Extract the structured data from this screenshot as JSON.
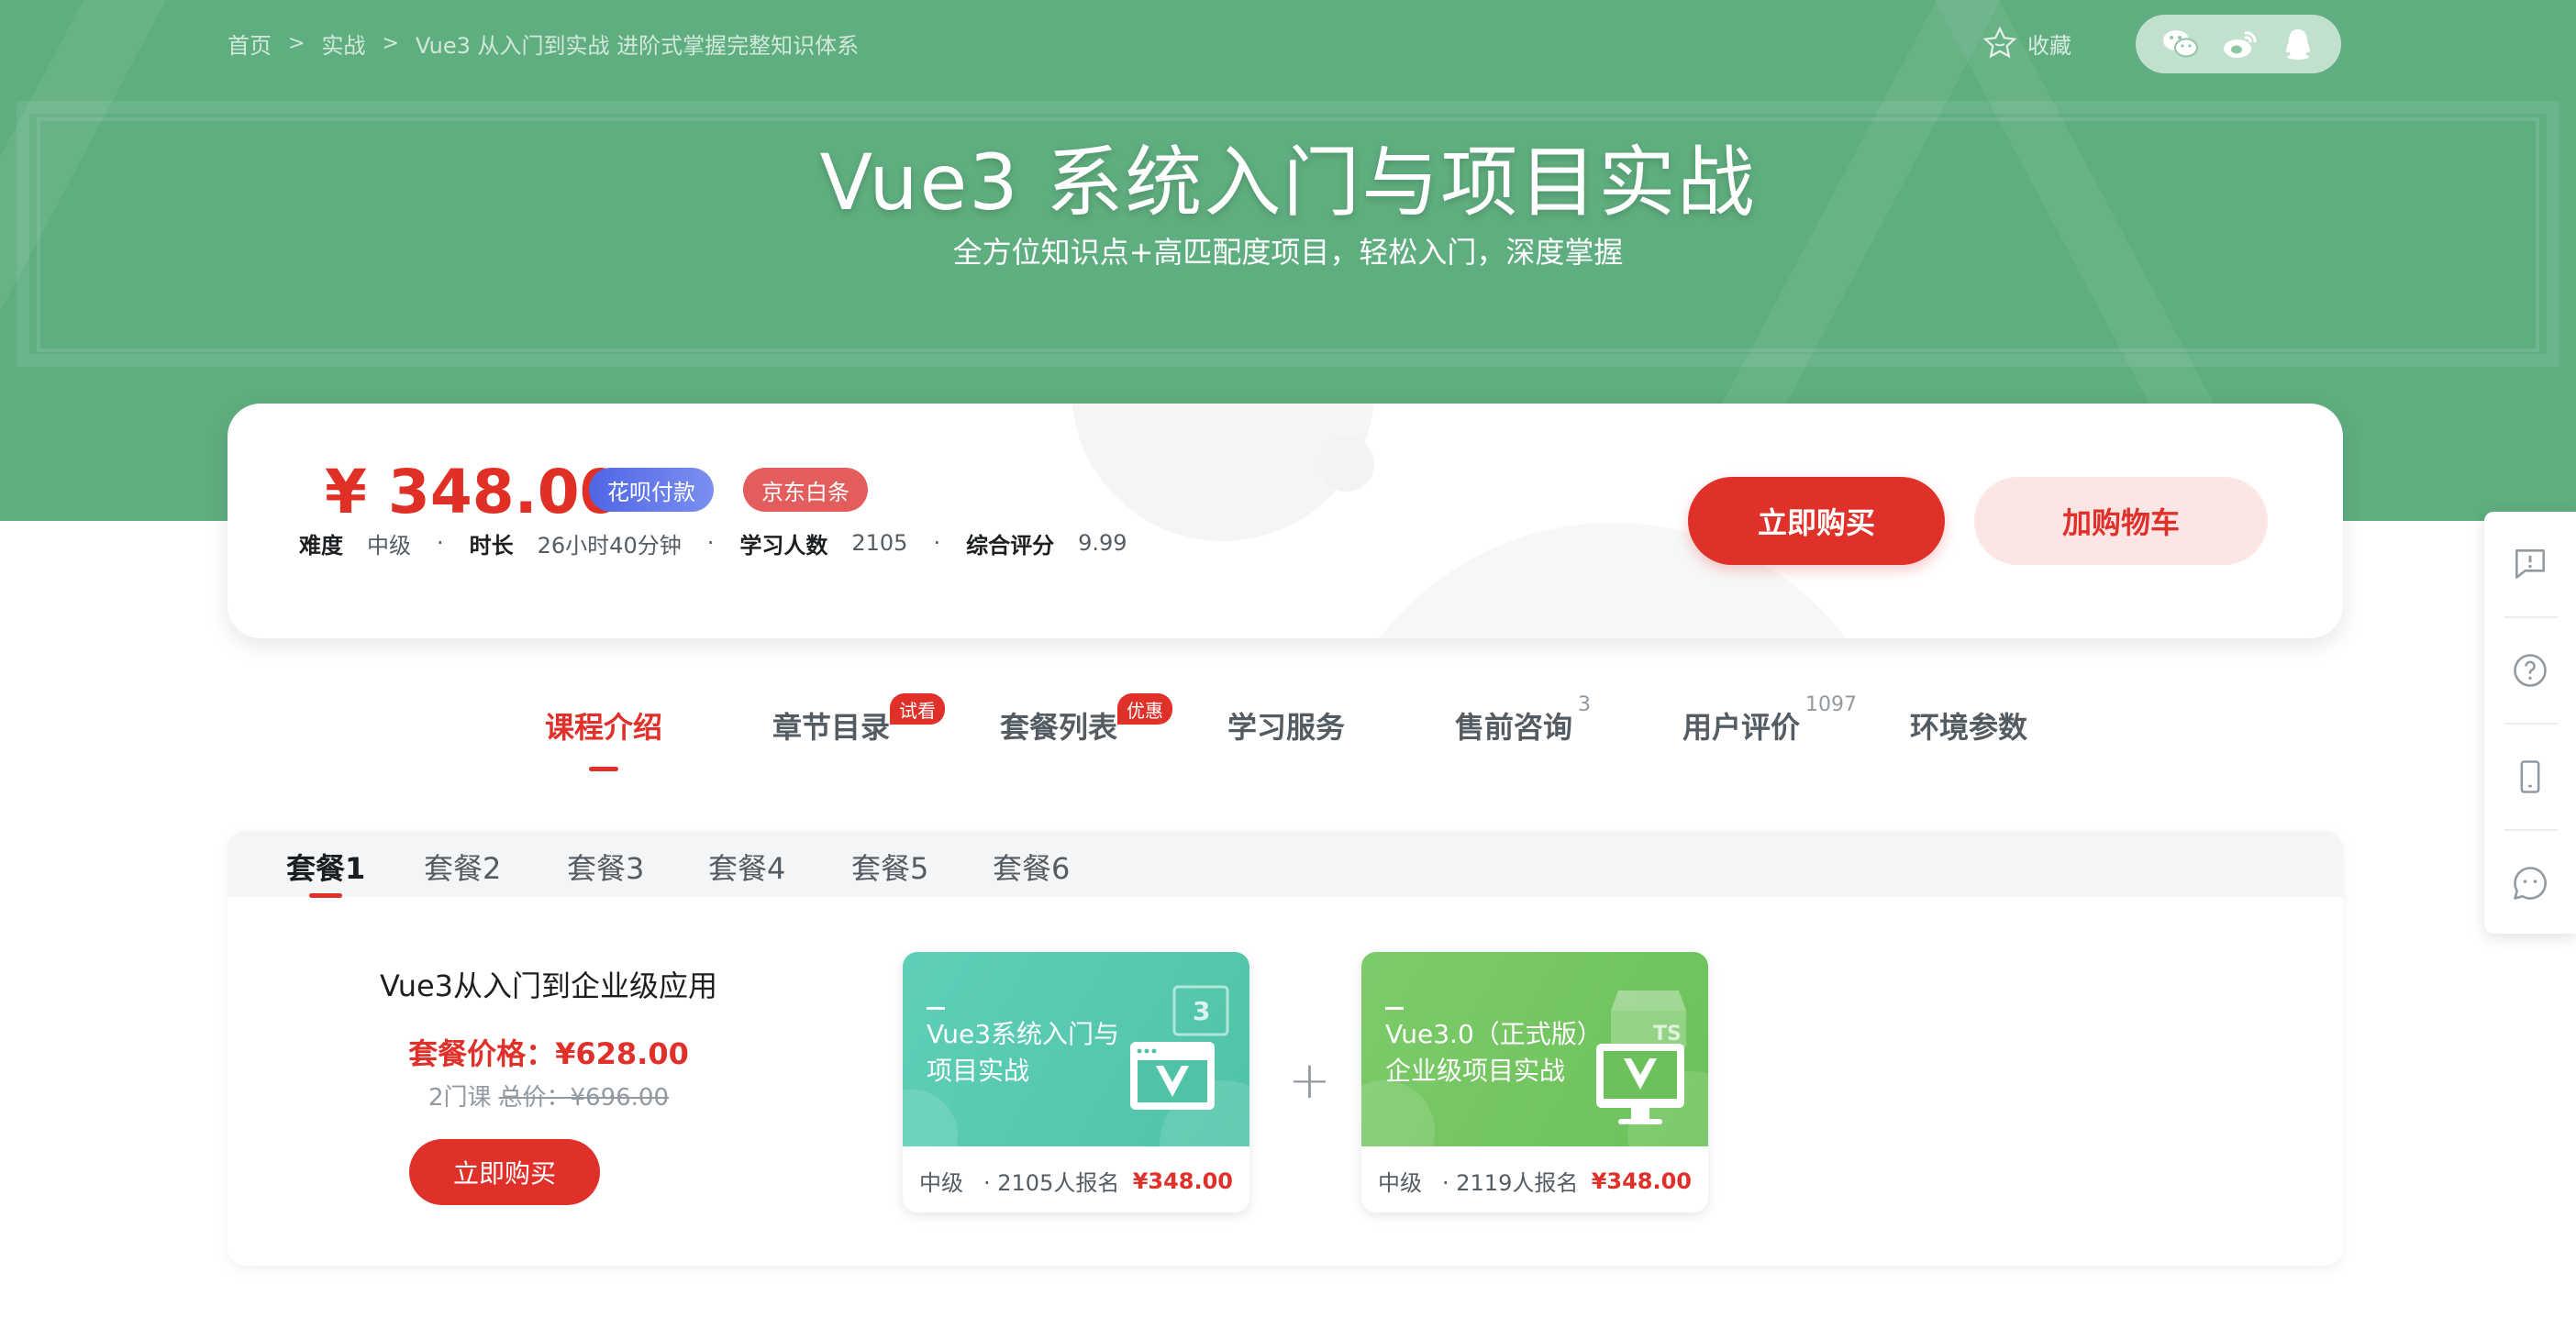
{
  "breadcrumb": {
    "items": [
      "首页",
      "实战",
      "Vue3 从入门到实战 进阶式掌握完整知识体系"
    ],
    "separator": ">"
  },
  "header": {
    "favorite_label": "收藏",
    "share_icons": [
      "wechat-icon",
      "weibo-icon",
      "qq-icon"
    ],
    "title": "Vue3 系统入门与项目实战",
    "subtitle": "全方位知识点+高匹配度项目，轻松入门，深度掌握",
    "background_color": "#5fae7f"
  },
  "course_card": {
    "price": "¥ 348.00",
    "badges": [
      {
        "label": "花呗付款",
        "color": "#5b6de8"
      },
      {
        "label": "京东白条",
        "color": "#e35d5d"
      }
    ],
    "meta": [
      {
        "label": "难度",
        "value": "中级"
      },
      {
        "label": "时长",
        "value": "26小时40分钟"
      },
      {
        "label": "学习人数",
        "value": "2105"
      },
      {
        "label": "综合评分",
        "value": "9.99"
      }
    ],
    "buy_label": "立即购买",
    "cart_label": "加购物车",
    "accent_color": "#e0302a"
  },
  "nav_tabs": [
    {
      "label": "课程介绍",
      "active": true
    },
    {
      "label": "章节目录",
      "tag": "试看"
    },
    {
      "label": "套餐列表",
      "tag": "优惠"
    },
    {
      "label": "学习服务"
    },
    {
      "label": "售前咨询",
      "count": "3"
    },
    {
      "label": "用户评价",
      "count": "1097"
    },
    {
      "label": "环境参数"
    }
  ],
  "packages": {
    "tabs": [
      "套餐1",
      "套餐2",
      "套餐3",
      "套餐4",
      "套餐5",
      "套餐6"
    ],
    "active_tab": "套餐1",
    "current": {
      "name": "Vue3从入门到企业级应用",
      "price": "套餐价格：¥628.00",
      "course_count": "2门课",
      "total_price": "总价：¥696.00",
      "buy_label": "立即购买"
    },
    "courses": [
      {
        "title": "Vue3系统入门与项目实战",
        "level": "中级",
        "enrolled": "· 2105人报名",
        "price": "¥348.00"
      },
      {
        "title": "Vue3.0（正式版）企业级项目实战",
        "level": "中级",
        "enrolled": "· 2119人报名",
        "price": "¥348.00"
      }
    ],
    "plus_sign": "+"
  },
  "side_tools": [
    "feedback-icon",
    "help-icon",
    "mobile-icon",
    "chat-icon"
  ]
}
